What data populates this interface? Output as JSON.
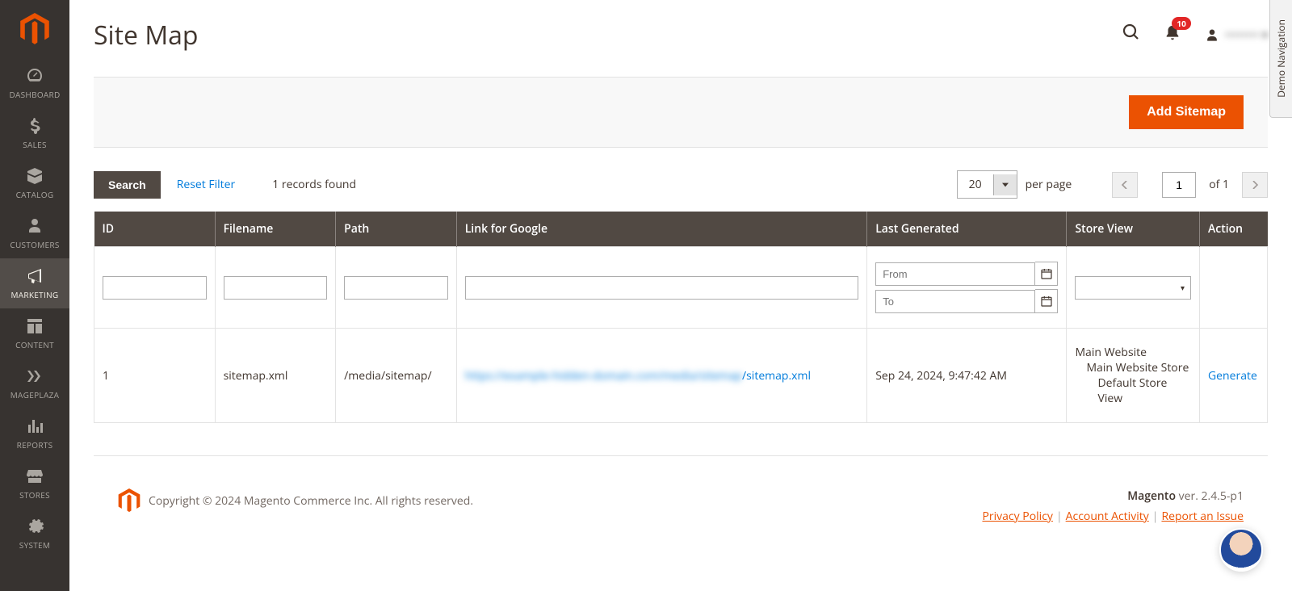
{
  "sidebar": {
    "items": [
      {
        "label": "DASHBOARD",
        "icon": "gauge"
      },
      {
        "label": "SALES",
        "icon": "dollar"
      },
      {
        "label": "CATALOG",
        "icon": "box"
      },
      {
        "label": "CUSTOMERS",
        "icon": "person"
      },
      {
        "label": "MARKETING",
        "icon": "megaphone",
        "active": true
      },
      {
        "label": "CONTENT",
        "icon": "layout"
      },
      {
        "label": "MAGEPLAZA",
        "icon": "mp"
      },
      {
        "label": "REPORTS",
        "icon": "bars"
      },
      {
        "label": "STORES",
        "icon": "store"
      },
      {
        "label": "SYSTEM",
        "icon": "gear"
      }
    ]
  },
  "header": {
    "title": "Site Map",
    "notifications": "10",
    "admin_user": "••••••••"
  },
  "actions": {
    "add_button": "Add Sitemap"
  },
  "toolbar": {
    "search_label": "Search",
    "reset_label": "Reset Filter",
    "records_found": "1 records found",
    "per_page_value": "20",
    "per_page_label": "per page",
    "current_page": "1",
    "of_label": "of",
    "total_pages": "1"
  },
  "grid": {
    "columns": [
      "ID",
      "Filename",
      "Path",
      "Link for Google",
      "Last Generated",
      "Store View",
      "Action"
    ],
    "filters": {
      "from_placeholder": "From",
      "to_placeholder": "To"
    },
    "rows": [
      {
        "id": "1",
        "filename": "sitemap.xml",
        "path": "/media/sitemap/",
        "link_hidden": "https://example-hidden-domain.com/media/sitemap",
        "link_visible": "/sitemap.xml",
        "last_generated": "Sep 24, 2024, 9:47:42 AM",
        "store_l0": "Main Website",
        "store_l1": "Main Website Store",
        "store_l2": "Default Store View",
        "action": "Generate"
      }
    ]
  },
  "footer": {
    "copyright": "Copyright © 2024 Magento Commerce Inc. All rights reserved.",
    "product": "Magento",
    "version": " ver. 2.4.5-p1",
    "links": {
      "privacy": "Privacy Policy",
      "activity": "Account Activity",
      "report": "Report an Issue"
    }
  },
  "demo_tab": "Demo Navigation"
}
